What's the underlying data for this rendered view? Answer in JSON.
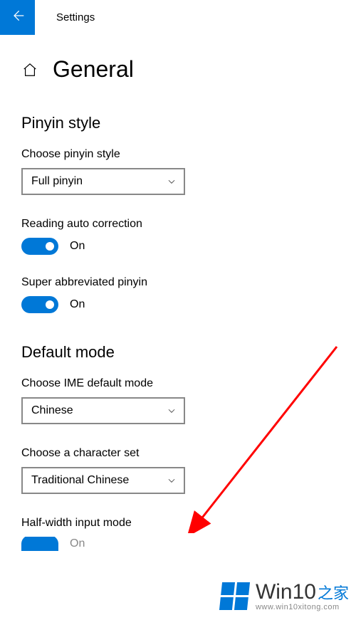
{
  "titlebar": {
    "title": "Settings"
  },
  "page": {
    "heading": "General"
  },
  "section_pinyin": {
    "header": "Pinyin style",
    "choose_label": "Choose pinyin style",
    "choose_value": "Full pinyin",
    "reading_label": "Reading auto correction",
    "reading_state": "On",
    "super_label": "Super abbreviated pinyin",
    "super_state": "On"
  },
  "section_default": {
    "header": "Default mode",
    "ime_label": "Choose IME default mode",
    "ime_value": "Chinese",
    "charset_label": "Choose a character set",
    "charset_value": "Traditional Chinese",
    "halfwidth_label": "Half-width input mode",
    "halfwidth_state": "On"
  },
  "watermark": {
    "brand1": "Win10",
    "brand2": "之家",
    "url": "www.win10xitong.com"
  }
}
